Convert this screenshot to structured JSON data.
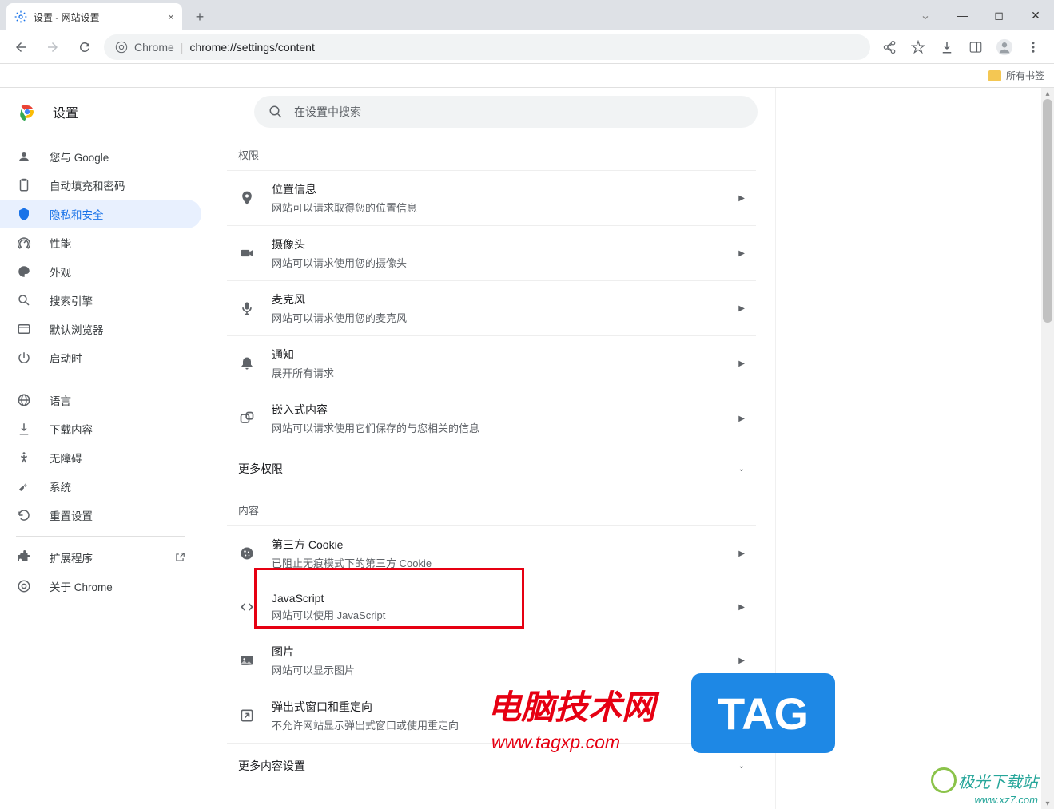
{
  "window": {
    "tab_title": "设置 - 网站设置",
    "new_tab": "+"
  },
  "nav": {
    "chrome_label": "Chrome",
    "url": "chrome://settings/content"
  },
  "bookmarks": {
    "all": "所有书签"
  },
  "settings": {
    "title": "设置",
    "search_placeholder": "在设置中搜索"
  },
  "sidebar": {
    "items": [
      {
        "label": "您与 Google"
      },
      {
        "label": "自动填充和密码"
      },
      {
        "label": "隐私和安全"
      },
      {
        "label": "性能"
      },
      {
        "label": "外观"
      },
      {
        "label": "搜索引擎"
      },
      {
        "label": "默认浏览器"
      },
      {
        "label": "启动时"
      },
      {
        "label": "语言"
      },
      {
        "label": "下载内容"
      },
      {
        "label": "无障碍"
      },
      {
        "label": "系统"
      },
      {
        "label": "重置设置"
      },
      {
        "label": "扩展程序"
      },
      {
        "label": "关于 Chrome"
      }
    ]
  },
  "panel": {
    "permissions_label": "权限",
    "content_label": "内容",
    "more_permissions": "更多权限",
    "more_content": "更多内容设置",
    "rows": {
      "location": {
        "title": "位置信息",
        "desc": "网站可以请求取得您的位置信息"
      },
      "camera": {
        "title": "摄像头",
        "desc": "网站可以请求使用您的摄像头"
      },
      "mic": {
        "title": "麦克风",
        "desc": "网站可以请求使用您的麦克风"
      },
      "notif": {
        "title": "通知",
        "desc": "展开所有请求"
      },
      "embed": {
        "title": "嵌入式内容",
        "desc": "网站可以请求使用它们保存的与您相关的信息"
      },
      "cookie": {
        "title": "第三方 Cookie",
        "desc": "已阻止无痕模式下的第三方 Cookie"
      },
      "js": {
        "title": "JavaScript",
        "desc": "网站可以使用 JavaScript"
      },
      "image": {
        "title": "图片",
        "desc": "网站可以显示图片"
      },
      "popup": {
        "title": "弹出式窗口和重定向",
        "desc": "不允许网站显示弹出式窗口或使用重定向"
      }
    }
  },
  "watermarks": {
    "w1": "电脑技术网",
    "w1_sub": "www.tagxp.com",
    "w2": "TAG",
    "w3": "极光下载站",
    "w3_url": "www.xz7.com"
  }
}
